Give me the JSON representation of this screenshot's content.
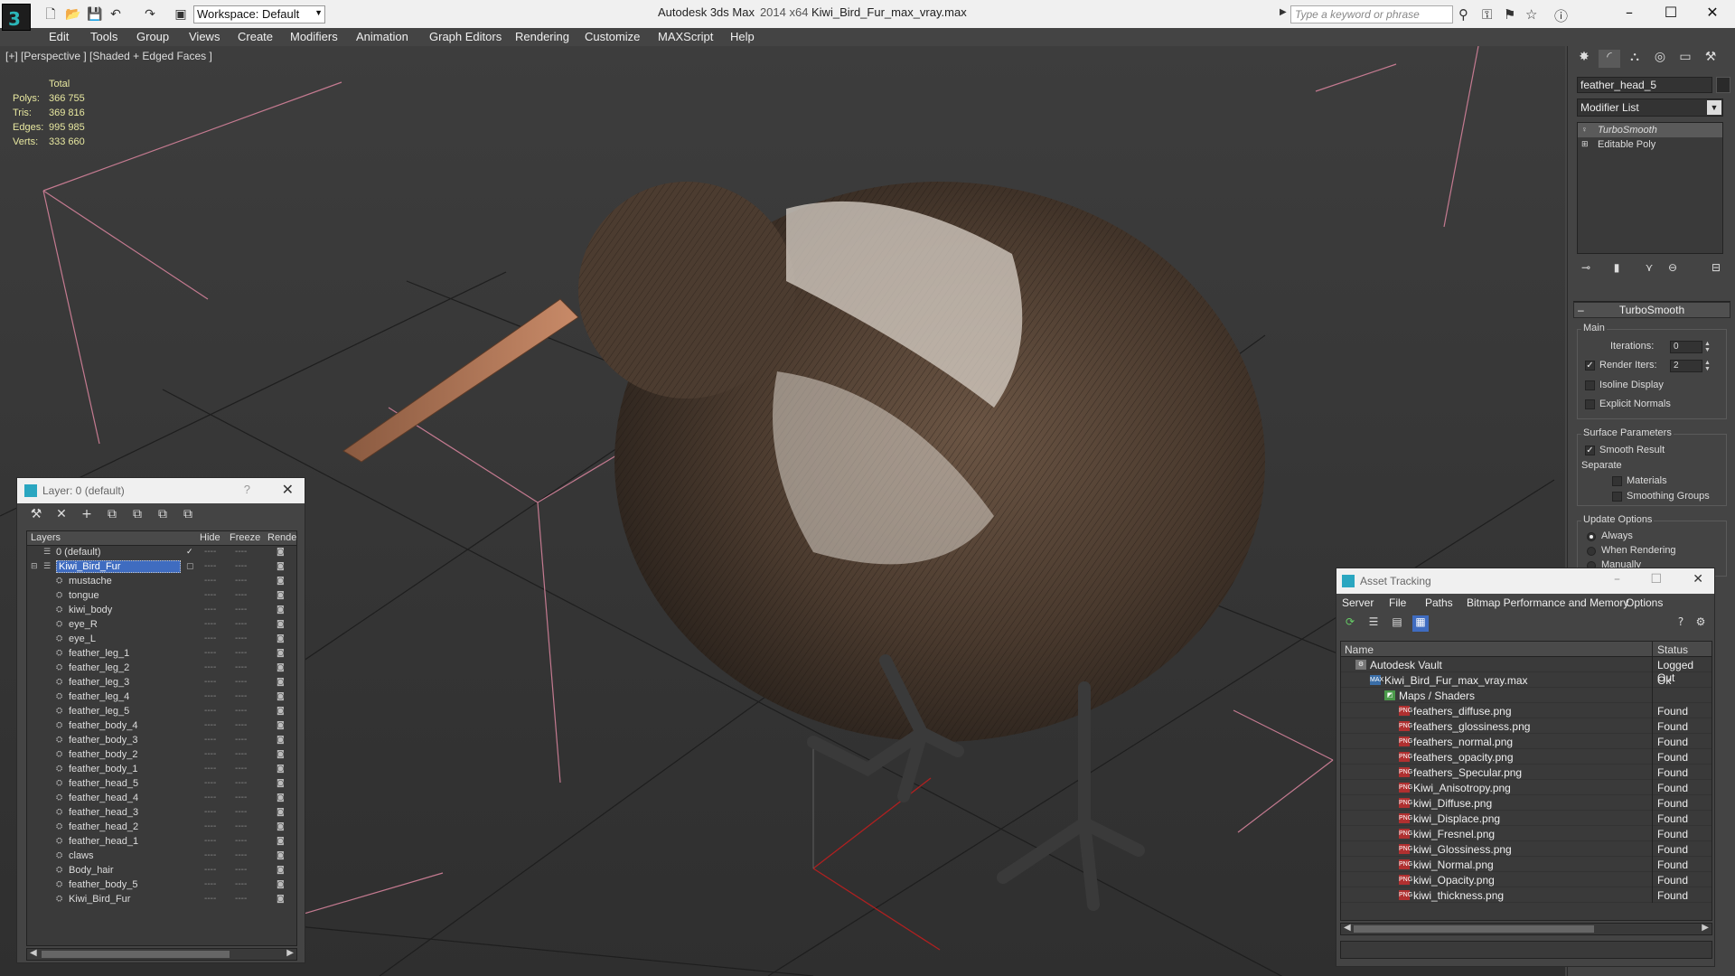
{
  "app": {
    "title": "Autodesk 3ds Max",
    "version": "2014 x64",
    "file": "Kiwi_Bird_Fur_max_vray.max",
    "workspace": "Workspace: Default",
    "search_placeholder": "Type a keyword or phrase"
  },
  "menu": [
    "Edit",
    "Tools",
    "Group",
    "Views",
    "Create",
    "Modifiers",
    "Animation",
    "Graph Editors",
    "Rendering",
    "Customize",
    "MAXScript",
    "Help"
  ],
  "viewport": {
    "label": "[+] [Perspective ] [Shaded + Edged Faces ]",
    "stats_header": "Total",
    "stats": [
      {
        "label": "Polys:",
        "value": "366 755"
      },
      {
        "label": "Tris:",
        "value": "369 816"
      },
      {
        "label": "Edges:",
        "value": "995 985"
      },
      {
        "label": "Verts:",
        "value": "333 660"
      }
    ]
  },
  "layer_dialog": {
    "title": "Layer: 0 (default)",
    "help": "?",
    "columns": {
      "layers": "Layers",
      "hide": "Hide",
      "freeze": "Freeze",
      "render": "Rende"
    },
    "rows": [
      {
        "name": "0 (default)",
        "level": 0,
        "check": "✓"
      },
      {
        "name": "Kiwi_Bird_Fur",
        "level": 0,
        "selected": true
      },
      {
        "name": "mustache",
        "level": 1
      },
      {
        "name": "tongue",
        "level": 1
      },
      {
        "name": "kiwi_body",
        "level": 1
      },
      {
        "name": "eye_R",
        "level": 1
      },
      {
        "name": "eye_L",
        "level": 1
      },
      {
        "name": "feather_leg_1",
        "level": 1
      },
      {
        "name": "feather_leg_2",
        "level": 1
      },
      {
        "name": "feather_leg_3",
        "level": 1
      },
      {
        "name": "feather_leg_4",
        "level": 1
      },
      {
        "name": "feather_leg_5",
        "level": 1
      },
      {
        "name": "feather_body_4",
        "level": 1
      },
      {
        "name": "feather_body_3",
        "level": 1
      },
      {
        "name": "feather_body_2",
        "level": 1
      },
      {
        "name": "feather_body_1",
        "level": 1
      },
      {
        "name": "feather_head_5",
        "level": 1
      },
      {
        "name": "feather_head_4",
        "level": 1
      },
      {
        "name": "feather_head_3",
        "level": 1
      },
      {
        "name": "feather_head_2",
        "level": 1
      },
      {
        "name": "feather_head_1",
        "level": 1
      },
      {
        "name": "claws",
        "level": 1
      },
      {
        "name": "Body_hair",
        "level": 1
      },
      {
        "name": "feather_body_5",
        "level": 1
      },
      {
        "name": "Kiwi_Bird_Fur",
        "level": 1
      }
    ]
  },
  "command_panel": {
    "object_name": "feather_head_5",
    "modifier_list": "Modifier List",
    "stack": [
      "TurboSmooth",
      "Editable Poly"
    ],
    "turbosmooth": {
      "title": "TurboSmooth",
      "main": "Main",
      "iterations_label": "Iterations:",
      "iterations": "0",
      "render_iters_label": "Render Iters:",
      "render_iters": "2",
      "isoline": "Isoline Display",
      "explicit_normals": "Explicit Normals",
      "surface_params": "Surface Parameters",
      "smooth_result": "Smooth Result",
      "separate": "Separate",
      "materials": "Materials",
      "smoothing_groups": "Smoothing Groups",
      "update_options": "Update Options",
      "always": "Always",
      "when_rendering": "When Rendering",
      "manually": "Manually"
    }
  },
  "asset_tracking": {
    "title": "Asset Tracking",
    "menu": [
      "Server",
      "File",
      "Paths",
      "Bitmap Performance and Memory",
      "Options"
    ],
    "columns": {
      "name": "Name",
      "status": "Status"
    },
    "rows": [
      {
        "name": "Autodesk Vault",
        "status": "Logged Out",
        "level": 0,
        "icon": "vault"
      },
      {
        "name": "Kiwi_Bird_Fur_max_vray.max",
        "status": "Ok",
        "level": 1,
        "icon": "max"
      },
      {
        "name": "Maps / Shaders",
        "status": "",
        "level": 2,
        "icon": "maps"
      },
      {
        "name": "feathers_diffuse.png",
        "status": "Found",
        "level": 3,
        "icon": "png"
      },
      {
        "name": "feathers_glossiness.png",
        "status": "Found",
        "level": 3,
        "icon": "png"
      },
      {
        "name": "feathers_normal.png",
        "status": "Found",
        "level": 3,
        "icon": "png"
      },
      {
        "name": "feathers_opacity.png",
        "status": "Found",
        "level": 3,
        "icon": "png"
      },
      {
        "name": "feathers_Specular.png",
        "status": "Found",
        "level": 3,
        "icon": "png"
      },
      {
        "name": "Kiwi_Anisotropy.png",
        "status": "Found",
        "level": 3,
        "icon": "png"
      },
      {
        "name": "kiwi_Diffuse.png",
        "status": "Found",
        "level": 3,
        "icon": "png"
      },
      {
        "name": "kiwi_Displace.png",
        "status": "Found",
        "level": 3,
        "icon": "png"
      },
      {
        "name": "kiwi_Fresnel.png",
        "status": "Found",
        "level": 3,
        "icon": "png"
      },
      {
        "name": "kiwi_Glossiness.png",
        "status": "Found",
        "level": 3,
        "icon": "png"
      },
      {
        "name": "kiwi_Normal.png",
        "status": "Found",
        "level": 3,
        "icon": "png"
      },
      {
        "name": "kiwi_Opacity.png",
        "status": "Found",
        "level": 3,
        "icon": "png"
      },
      {
        "name": "kiwi_thickness.png",
        "status": "Found",
        "level": 3,
        "icon": "png"
      }
    ]
  },
  "colors": {
    "accent": "#2bb6b8",
    "selection": "#3f6cc0",
    "stats": "#e8e8a0",
    "gizmo": "#d0809a"
  }
}
